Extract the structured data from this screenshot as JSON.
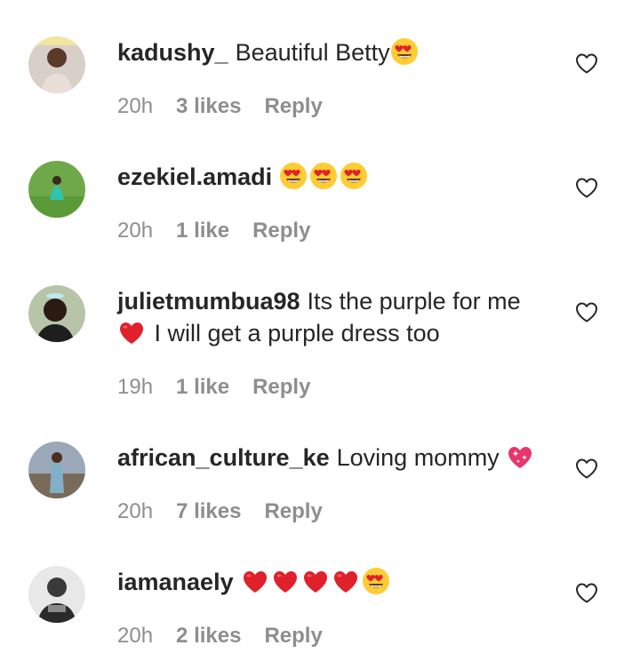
{
  "comments": [
    {
      "username": "kadushy_",
      "text": "Beautiful Betty",
      "emojis": [
        "heart-eyes-emoji"
      ],
      "time": "20h",
      "likes": "3 likes",
      "reply": "Reply"
    },
    {
      "username": "ezekiel.amadi",
      "text": "",
      "emojis": [
        "heart-eyes-emoji",
        "heart-eyes-emoji",
        "heart-eyes-emoji"
      ],
      "time": "20h",
      "likes": "1 like",
      "reply": "Reply"
    },
    {
      "username": "julietmumbua98",
      "text_line1": "Its the purple for me",
      "text_line2": "I will get a purple dress too",
      "emojis": [
        "red-heart-emoji"
      ],
      "time": "19h",
      "likes": "1 like",
      "reply": "Reply"
    },
    {
      "username": "african_culture_ke",
      "text": "Loving mommy",
      "emojis": [
        "sparkling-heart-emoji"
      ],
      "time": "20h",
      "likes": "7 likes",
      "reply": "Reply"
    },
    {
      "username": "iamanaely",
      "text": "",
      "emojis": [
        "red-heart-emoji",
        "red-heart-emoji",
        "red-heart-emoji",
        "red-heart-emoji",
        "heart-eyes-emoji"
      ],
      "time": "20h",
      "likes": "2 likes",
      "reply": "Reply"
    }
  ],
  "colors": {
    "text": "#262626",
    "meta": "#8e8e8e",
    "emoji_red": "#e0202a",
    "emoji_yellow": "#ffcc33"
  }
}
